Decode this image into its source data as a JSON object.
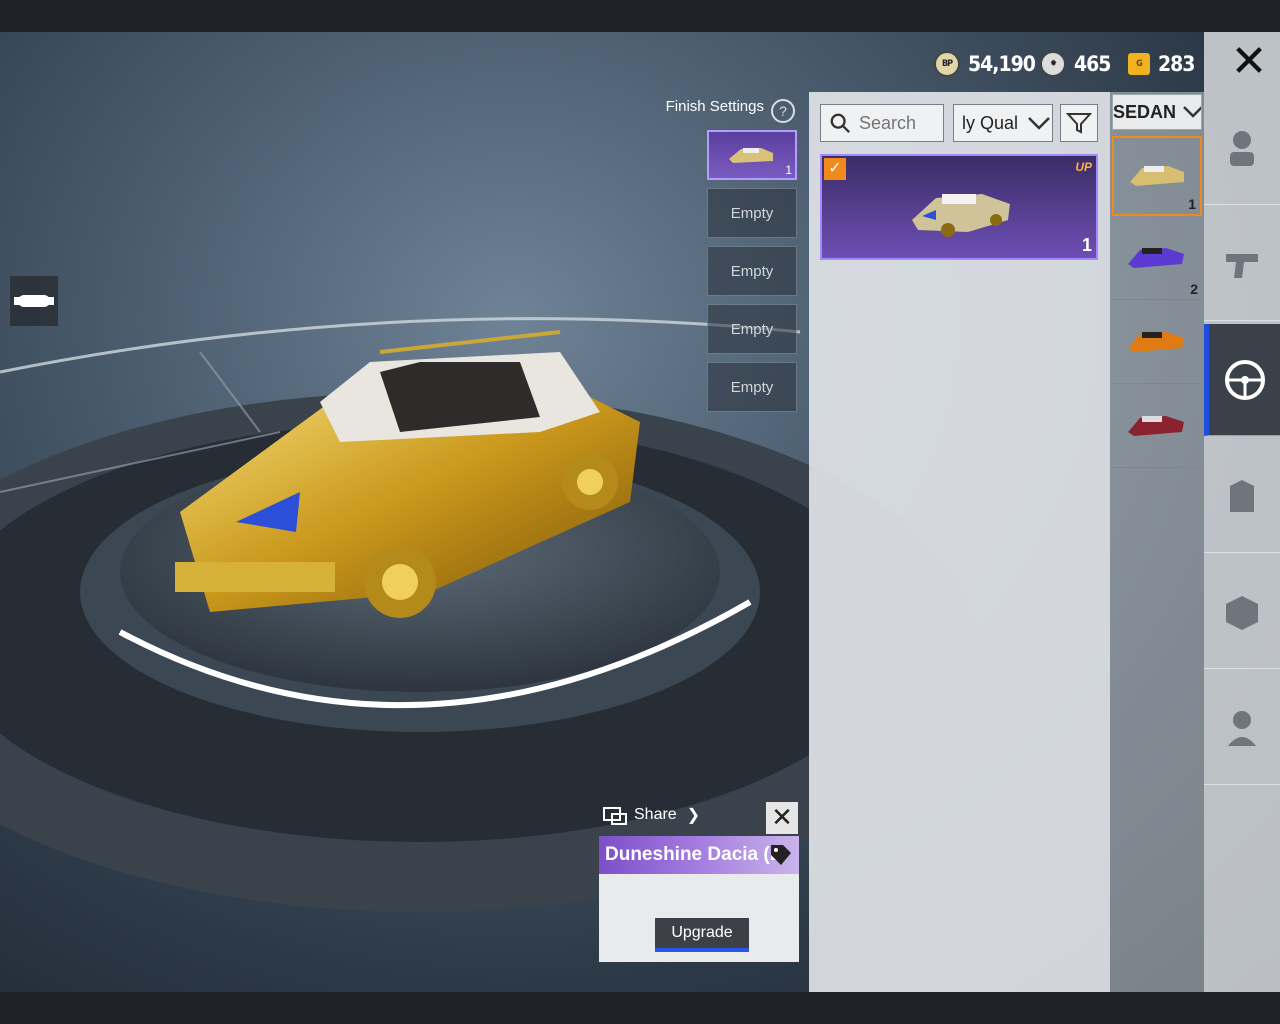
{
  "currencies": [
    {
      "icon": "bp-coin-icon",
      "label": "BP",
      "value": "54,190"
    },
    {
      "icon": "silver-fragment-icon",
      "label": "",
      "value": "465"
    },
    {
      "icon": "g-coin-icon",
      "label": "G",
      "value": "283"
    }
  ],
  "finish": {
    "label": "Finish Settings",
    "help": "?",
    "slots": [
      {
        "label": "",
        "num": "1"
      },
      {
        "label": "Empty"
      },
      {
        "label": "Empty"
      },
      {
        "label": "Empty"
      },
      {
        "label": "Empty"
      }
    ]
  },
  "filters": {
    "search_placeholder": "Search",
    "quality_value": "ly Qual",
    "category_value": "SEDAN"
  },
  "item": {
    "badge": "UP",
    "count": "1"
  },
  "categories": [
    {
      "num": "1"
    },
    {
      "num": "2"
    },
    {
      "num": ""
    },
    {
      "num": ""
    }
  ],
  "share": {
    "label": "Share"
  },
  "info": {
    "title": "Duneshine Dacia (L",
    "upgrade": "Upgrade"
  },
  "colors": {
    "accent": "#f08a1c",
    "active_blue": "#1e4ee0",
    "card_purple": "#6e4fb4"
  }
}
